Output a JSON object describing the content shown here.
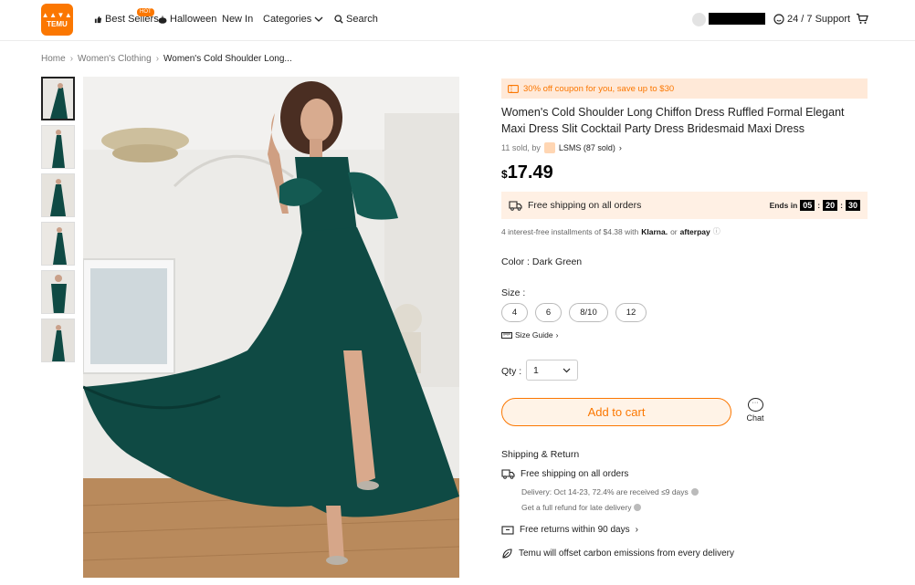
{
  "header": {
    "logo_line1": "▲▲▼▲",
    "logo_line2": "TEMU",
    "nav": {
      "best_sellers": "Best Sellers",
      "hot_badge": "HOT",
      "halloween": "Halloween",
      "new_in": "New In",
      "categories": "Categories",
      "search": "Search"
    },
    "support": "24 / 7 Support"
  },
  "breadcrumb": [
    "Home",
    "Women's Clothing",
    "Women's Cold Shoulder Long..."
  ],
  "breadcrumb_sep": "›",
  "product": {
    "coupon": "30% off coupon for you, save up to $30",
    "title": "Women's Cold Shoulder Long Chiffon Dress Ruffled Formal Elegant Maxi Dress Slit Cocktail Party Dress Bridesmaid Maxi Dress",
    "sold": "11 sold, by",
    "store": "LSMS (87 sold)",
    "currency": "$",
    "price": "17.49",
    "free_shipping": "Free shipping on all orders",
    "ends_in": "Ends in",
    "timer": [
      "05",
      "20",
      "30"
    ],
    "installments": "4 interest-free installments of $4.38 with",
    "klarna": "Klarna.",
    "or": "or",
    "afterpay": "afterpay",
    "color_label": "Color :",
    "color_value": "Dark Green",
    "size_label": "Size :",
    "sizes": [
      "4",
      "6",
      "8/10",
      "12"
    ],
    "size_guide": "Size Guide",
    "qty_label": "Qty :",
    "qty_value": "1",
    "add_to_cart": "Add to cart",
    "chat": "Chat"
  },
  "shipping": {
    "title": "Shipping & Return",
    "free_shipping": "Free shipping on all orders",
    "delivery": "Delivery: Oct 14-23, 72.4% are received ≤9 days",
    "refund": "Get a full refund for late delivery",
    "returns": "Free returns within 90 days",
    "carbon": "Temu will offset carbon emissions from every delivery"
  },
  "colors": {
    "brand": "#fb7701",
    "dress": "#0f4a44"
  }
}
